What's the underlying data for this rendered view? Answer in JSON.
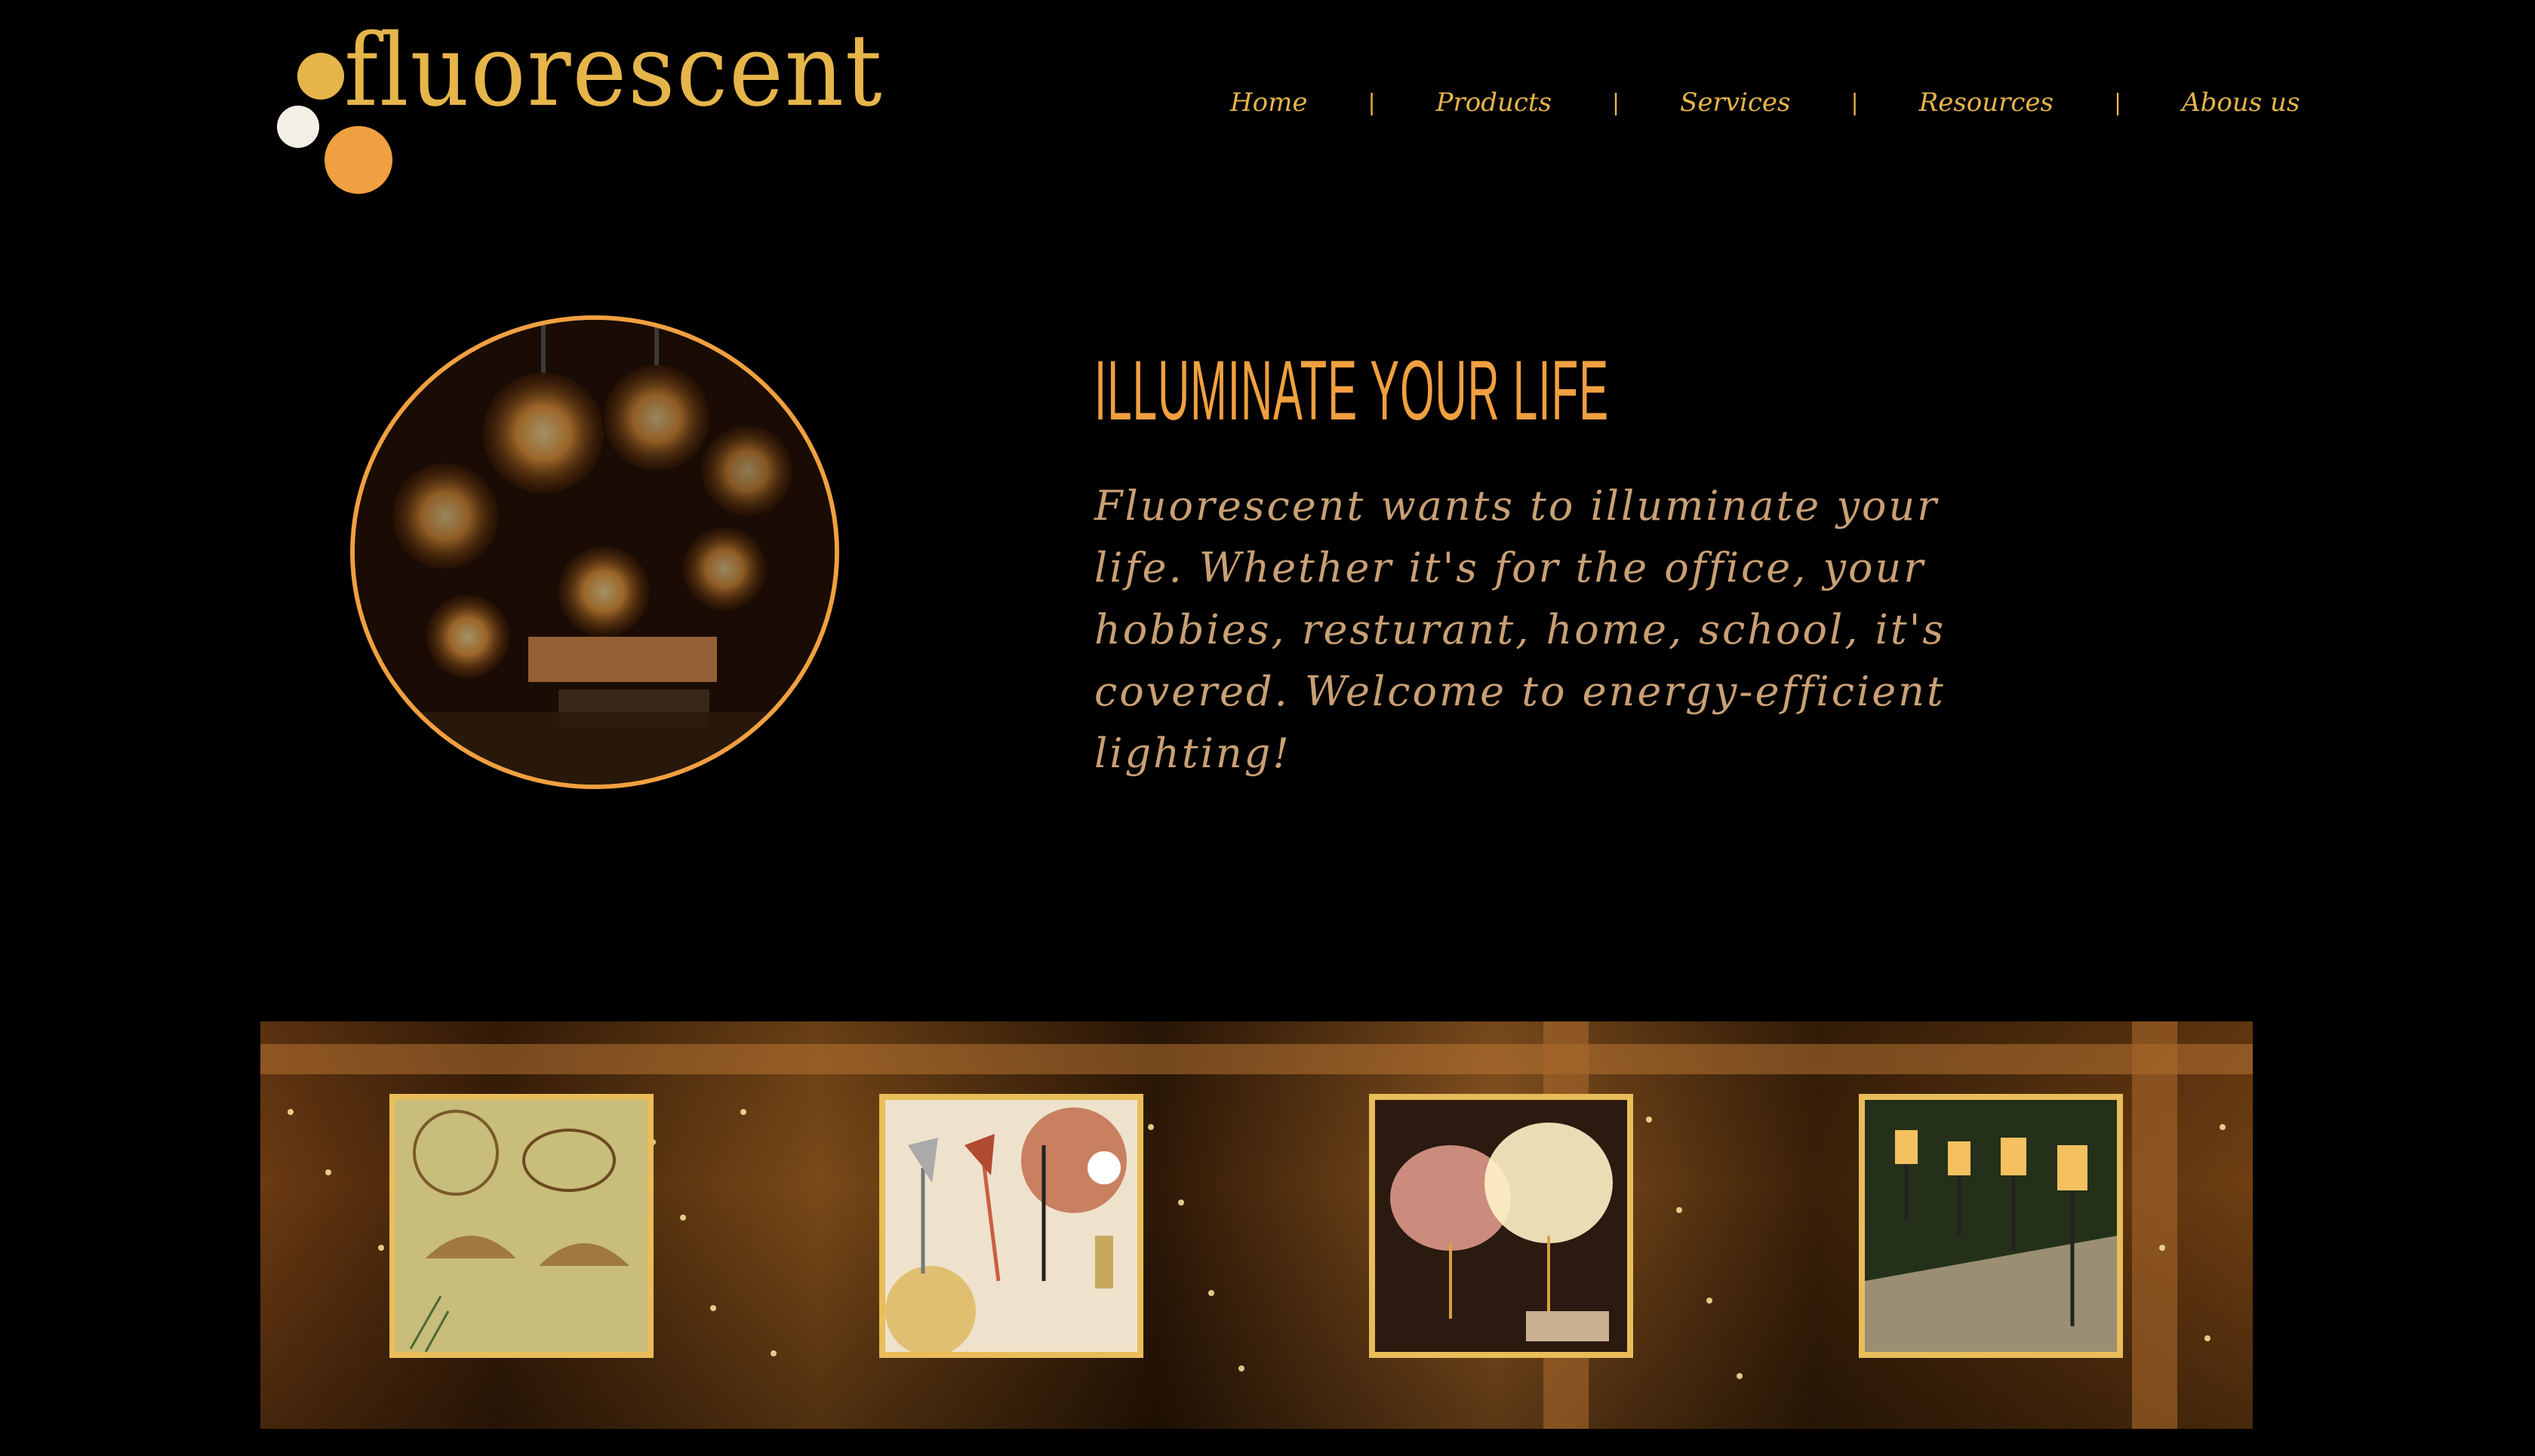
{
  "brand": {
    "name": "fluorescent",
    "colors": {
      "accent": "#f0a040",
      "gold": "#e6b54a",
      "body_text": "#c9a074",
      "background": "#000000"
    }
  },
  "nav": {
    "items": [
      {
        "label": "Home"
      },
      {
        "label": "Products"
      },
      {
        "label": "Services"
      },
      {
        "label": "Resources"
      },
      {
        "label": "Abous us"
      }
    ],
    "separator": "|"
  },
  "hero": {
    "heading": "ILLUMINATE YOUR LIFE",
    "body": "Fluorescent wants to illuminate your life. Whether it's for the office, your hobbies, resturant, home, school, it's covered. Welcome to energy-efficient lighting!"
  }
}
